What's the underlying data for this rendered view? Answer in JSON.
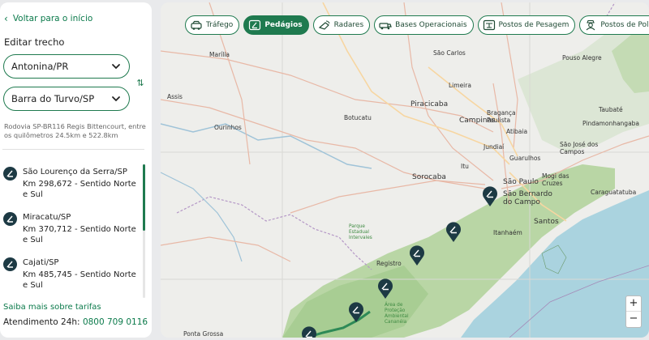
{
  "sidebar": {
    "back_label": "Voltar para o início",
    "section_title": "Editar trecho",
    "origin": "Antonina/PR",
    "destination": "Barra do Turvo/SP",
    "description": "Rodovia SP-BR116 Regis Bittencourt, entre os quilômetros 24.5km e 522.8km",
    "items": [
      {
        "name": "São Lourenço da Serra/SP",
        "km": "Km 298,672 - Sentido Norte e Sul"
      },
      {
        "name": "Miracatu/SP",
        "km": "Km 370,712 - Sentido Norte e Sul"
      },
      {
        "name": "Cajati/SP",
        "km": "Km 485,745 - Sentido Norte e Sul"
      }
    ],
    "more_link": "Saiba mais sobre tarifas",
    "support_label": "Atendimento 24h:",
    "support_phone": "0800 709 0116"
  },
  "map": {
    "chips": [
      {
        "label": "Tráfego",
        "icon": "car-icon",
        "active": false
      },
      {
        "label": "Pedágios",
        "icon": "toll-icon",
        "active": true
      },
      {
        "label": "Radares",
        "icon": "radar-icon",
        "active": false
      },
      {
        "label": "Bases Operacionais",
        "icon": "base-icon",
        "active": false
      },
      {
        "label": "Postos de Pesagem",
        "icon": "scale-icon",
        "active": false
      },
      {
        "label": "Postos de Polícia",
        "icon": "police-icon",
        "active": false
      }
    ],
    "labels": {
      "piracicaba": "Piracicaba",
      "campinas": "Campinas",
      "jundiai": "Jundiaí",
      "sorocaba": "Sorocaba",
      "sao_paulo": "São Paulo",
      "sao_bernardo": "São Bernardo\ndo Campo",
      "santos": "Santos",
      "sao_jose": "São José dos\nCampos",
      "botucatu": "Botucatu",
      "ourinhos": "Ourinhos",
      "assis": "Assis",
      "marilia": "Marília",
      "limeira": "Limeira",
      "sao_carlos": "São Carlos",
      "itu": "Itu",
      "braganca": "Bragança\nPaulista",
      "atibaia": "Atibaia",
      "guarulhos": "Guarulhos",
      "mogi": "Mogi das\nCruzes",
      "itanhaem": "Itanhaém",
      "ponta_grossa": "Ponta Grossa",
      "pindamonhangaba": "Pindamonhangaba",
      "caraguatatuba": "Caraguatatuba",
      "taubate": "Taubaté",
      "pouso_alegre": "Pouso Alegre",
      "registro": "Registro",
      "apa": "Área de\nProteção\nAmbiental\nCananéia",
      "pe": "Parque\nEstadual\nIntervales"
    },
    "zoom_in": "+",
    "zoom_out": "−"
  }
}
